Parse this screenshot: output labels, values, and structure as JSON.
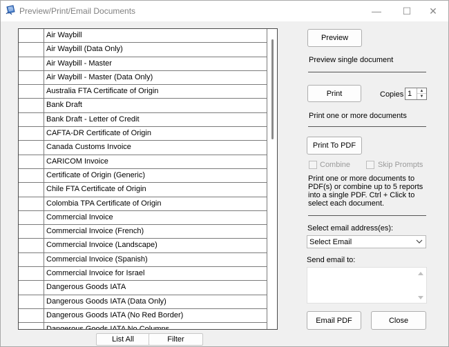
{
  "window": {
    "title": "Preview/Print/Email Documents",
    "minimize_glyph": "—",
    "maximize_glyph": "☐",
    "close_glyph": "✕"
  },
  "documents": [
    "Air Waybill",
    "Air Waybill  (Data Only)",
    "Air Waybill - Master",
    "Air Waybill - Master (Data Only)",
    "Australia FTA Certificate of Origin",
    "Bank Draft",
    "Bank Draft - Letter of Credit",
    "CAFTA-DR Certificate of Origin",
    "Canada Customs Invoice",
    "CARICOM Invoice",
    "Certificate of Origin (Generic)",
    "Chile FTA Certificate of Origin",
    "Colombia TPA Certificate of Origin",
    "Commercial Invoice",
    "Commercial Invoice (French)",
    "Commercial Invoice (Landscape)",
    "Commercial Invoice (Spanish)",
    "Commercial Invoice for Israel",
    "Dangerous Goods IATA",
    "Dangerous Goods IATA (Data Only)",
    "Dangerous Goods IATA (No Red Border)",
    "Dangerous Goods IATA No Columns"
  ],
  "list_buttons": {
    "list_all": "List All",
    "filter": "Filter"
  },
  "preview": {
    "button": "Preview",
    "description": "Preview single document"
  },
  "print": {
    "button": "Print",
    "copies_label": "Copies",
    "copies_value": "1",
    "description": "Print one or more documents"
  },
  "pdf": {
    "button": "Print To PDF",
    "combine_label": "Combine",
    "skip_prompts_label": "Skip Prompts",
    "description": "Print one or more documents to PDF(s) or combine up to 5 reports into a single PDF. Ctrl + Click to select each document."
  },
  "email": {
    "select_label": "Select email address(es):",
    "select_value": "Select Email",
    "send_to_label": "Send email to:",
    "send_to_value": "",
    "button": "Email PDF"
  },
  "close_button": "Close",
  "colors": {
    "window_bg": "#f0f0f0",
    "disabled_text": "#9a9a9a"
  }
}
